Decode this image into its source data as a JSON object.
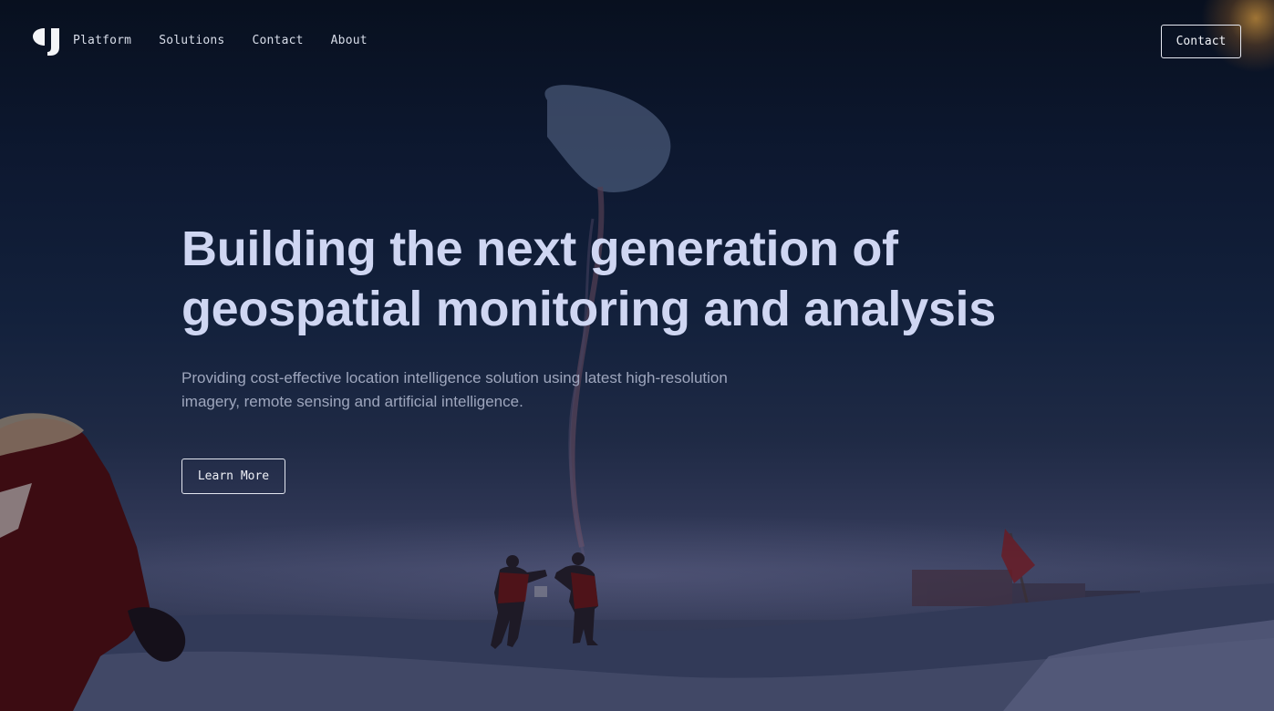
{
  "nav": {
    "logo_icon": "brand-logo-icon",
    "links": [
      {
        "label": "Platform"
      },
      {
        "label": "Solutions"
      },
      {
        "label": "Contact"
      },
      {
        "label": "About"
      }
    ],
    "cta_label": "Contact"
  },
  "hero": {
    "title_line1": "Building the next generation of",
    "title_line2": "geospatial monitoring and analysis",
    "subtitle_line1": "Providing cost-effective location intelligence solution using latest high-resolution",
    "subtitle_line2": "imagery, remote sensing and artificial intelligence.",
    "cta_label": "Learn More"
  },
  "colors": {
    "background": "#0c1426",
    "title": "#cfd6f2",
    "subtitle": "#9ea6bd",
    "button_border": "#e6e9f2"
  }
}
